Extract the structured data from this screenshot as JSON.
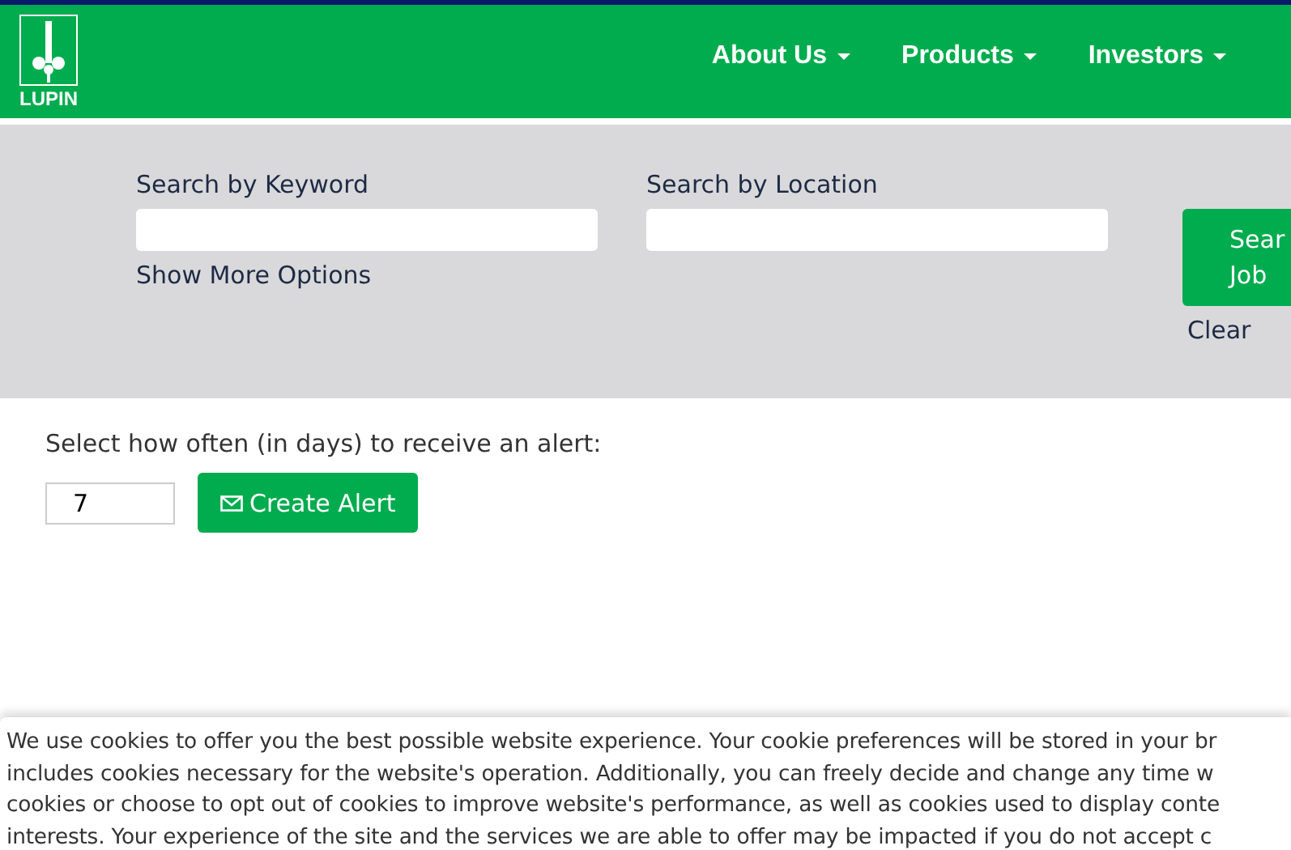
{
  "header": {
    "logo_text": "LUPIN",
    "nav": [
      {
        "label": "About Us"
      },
      {
        "label": "Products"
      },
      {
        "label": "Investors"
      }
    ]
  },
  "search": {
    "keyword_label": "Search by Keyword",
    "location_label": "Search by Location",
    "more_options": "Show More Options",
    "search_button": [
      "Sear",
      "Job"
    ],
    "clear": "Clear"
  },
  "alert": {
    "label": "Select how often (in days) to receive an alert:",
    "days": "7",
    "button": "Create Alert"
  },
  "cookie_banner": {
    "lines": [
      "We use cookies to offer you the best possible website experience. Your cookie preferences will be stored in your br",
      "includes cookies necessary for the website's operation. Additionally, you can freely decide and change any time w",
      "cookies or choose to opt out of cookies to improve website's performance, as well as cookies used to display conte",
      "interests. Your experience of the site and the services we are able to offer may be impacted if you do not accept c"
    ]
  }
}
